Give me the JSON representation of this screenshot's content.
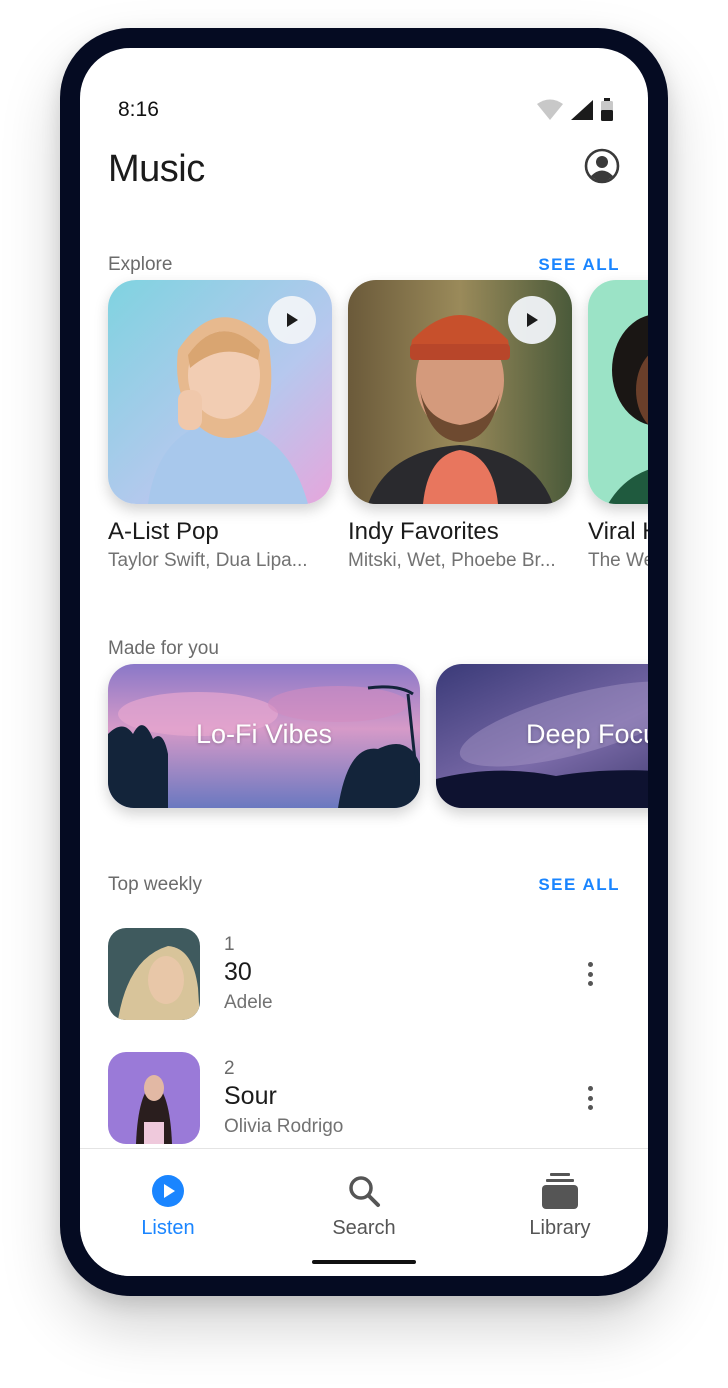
{
  "status": {
    "time": "8:16"
  },
  "header": {
    "title": "Music"
  },
  "explore": {
    "label": "Explore",
    "see_all": "SEE ALL",
    "cards": [
      {
        "title": "A-List Pop",
        "subtitle": "Taylor Swift, Dua Lipa..."
      },
      {
        "title": "Indy Favorites",
        "subtitle": "Mitski, Wet, Phoebe Br..."
      },
      {
        "title": "Viral H",
        "subtitle": "The We"
      }
    ]
  },
  "made_for_you": {
    "label": "Made for you",
    "mixes": [
      {
        "label": "Lo-Fi Vibes"
      },
      {
        "label": "Deep Focu"
      }
    ]
  },
  "top_weekly": {
    "label": "Top weekly",
    "see_all": "SEE ALL",
    "items": [
      {
        "rank": "1",
        "title": "30",
        "artist": "Adele"
      },
      {
        "rank": "2",
        "title": "Sour",
        "artist": "Olivia Rodrigo"
      }
    ]
  },
  "nav": {
    "items": [
      {
        "label": "Listen",
        "icon": "play-circle-icon",
        "active": true
      },
      {
        "label": "Search",
        "icon": "search-icon",
        "active": false
      },
      {
        "label": "Library",
        "icon": "library-icon",
        "active": false
      }
    ]
  },
  "colors": {
    "accent": "#1a85ff",
    "frame": "#050b22"
  }
}
